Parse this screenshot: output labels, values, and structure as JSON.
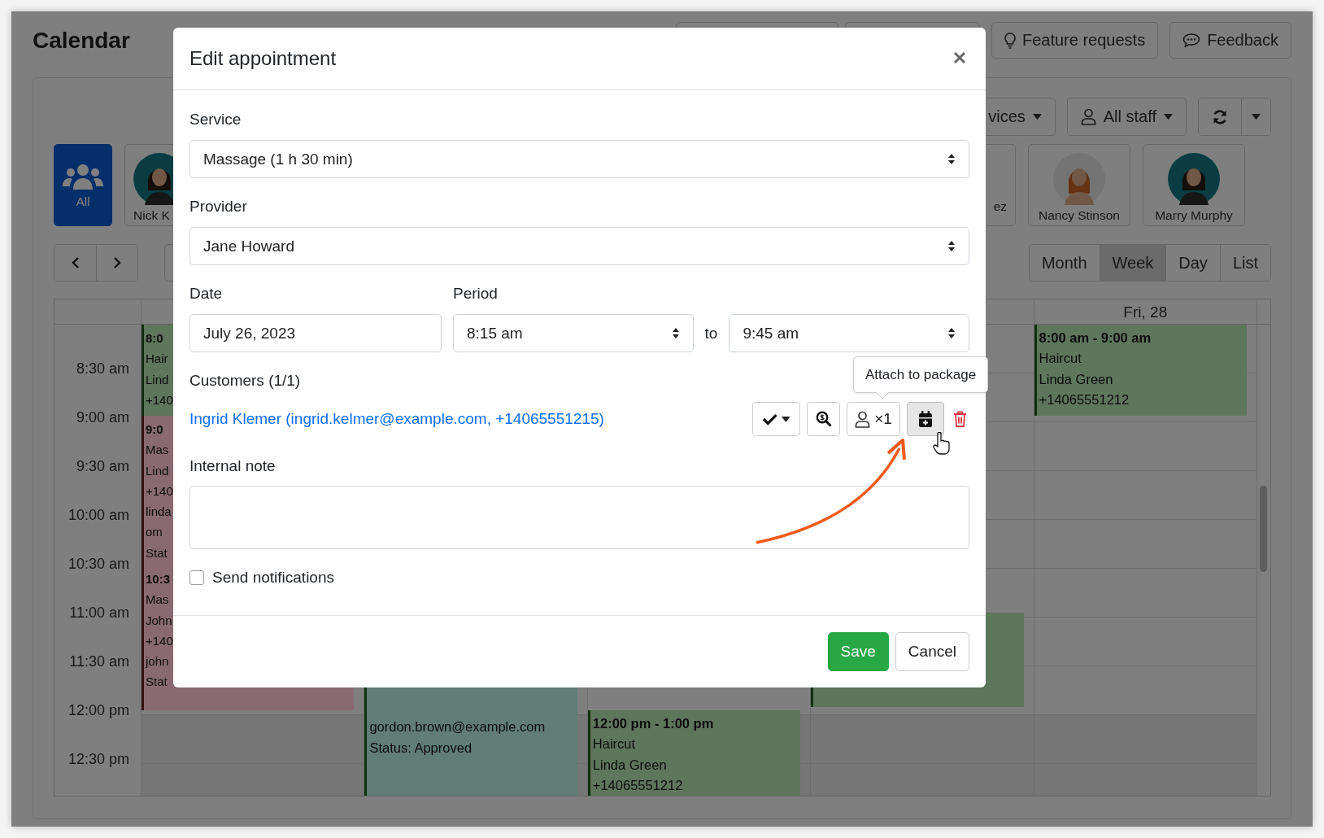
{
  "page": {
    "title": "Calendar"
  },
  "top_buttons": [
    {
      "kind": "blank"
    },
    {
      "kind": "blank"
    },
    {
      "kind": "bulb",
      "label": "Feature requests"
    },
    {
      "kind": "chat",
      "label": "Feedback"
    }
  ],
  "filters": [
    {
      "kind": "dropdown",
      "label": "vices"
    },
    {
      "kind": "staff",
      "label": "All staff"
    },
    {
      "kind": "refresh"
    }
  ],
  "staff": [
    {
      "kind": "group",
      "name": "All",
      "selected": true
    },
    {
      "kind": "avatar_circle",
      "name": "Nick K",
      "selected": false
    },
    {
      "kind": "hidden",
      "name": "ez",
      "selected": false
    },
    {
      "kind": "avatar_plain",
      "name": "Nancy Stinson",
      "selected": false
    },
    {
      "kind": "avatar_circle",
      "name": "Marry Murphy",
      "selected": false
    }
  ],
  "views": [
    {
      "label": "Month",
      "selected": false
    },
    {
      "label": "Week",
      "selected": true
    },
    {
      "label": "Day",
      "selected": false
    },
    {
      "label": "List",
      "selected": false
    }
  ],
  "calendar": {
    "times": [
      "8:30 am",
      "9:00 am",
      "9:30 am",
      "10:00 am",
      "10:30 am",
      "11:00 am",
      "11:30 am",
      "12:00 pm",
      "12:30 pm"
    ],
    "columns": [
      {
        "events": [
          {
            "color": "#5e765c",
            "lines": [
              {
                "text": "8:0",
                "bold": true
              },
              {
                "text": "Hair",
                "bold": false
              },
              {
                "text": "Lind",
                "bold": false
              },
              {
                "text": "+140",
                "bold": false
              }
            ]
          },
          {
            "color": "#8a6a72",
            "lines": [
              {
                "text": "9:0",
                "bold": true
              },
              {
                "text": "Mas",
                "bold": false
              },
              {
                "text": "Lind",
                "bold": false
              },
              {
                "text": "+140",
                "bold": false
              },
              {
                "text": "linda",
                "bold": false
              },
              {
                "text": "om",
                "bold": false
              },
              {
                "text": "Stat",
                "bold": false
              }
            ]
          },
          {
            "color": "#8a6a72",
            "lines": [
              {
                "text": "10:3",
                "bold": true
              },
              {
                "text": "Mas",
                "bold": false
              },
              {
                "text": "John",
                "bold": false
              },
              {
                "text": "+140",
                "bold": false
              },
              {
                "text": "john",
                "bold": false
              },
              {
                "text": "Stat",
                "bold": false
              }
            ]
          }
        ]
      },
      {
        "events": [
          {
            "color": "#607d76",
            "lines": [
              {
                "text": "gordon.brown@example.com",
                "bold": false
              },
              {
                "text": "Status: Approved",
                "bold": false
              }
            ]
          }
        ]
      },
      {
        "events": [
          {
            "color": "#5e765c",
            "lines": [
              {
                "text": "12:00 pm - 1:00 pm",
                "bold": true
              },
              {
                "text": "Haircut",
                "bold": false
              },
              {
                "text": "Linda Green",
                "bold": false
              },
              {
                "text": "+14065551212",
                "bold": false
              }
            ]
          }
        ]
      },
      {
        "events": [
          {
            "color": "#5e765c"
          }
        ]
      },
      {
        "header": "Fri, 28",
        "events": [
          {
            "color": "#5e765c",
            "lines": [
              {
                "text": "8:00 am - 9:00 am",
                "bold": true
              },
              {
                "text": "Haircut",
                "bold": false
              },
              {
                "text": "Linda Green",
                "bold": false
              },
              {
                "text": "+14065551212",
                "bold": false
              }
            ]
          }
        ]
      }
    ]
  },
  "modal": {
    "title": "Edit appointment",
    "service": {
      "label": "Service",
      "value": "Massage (1 h 30 min)"
    },
    "provider": {
      "label": "Provider",
      "value": "Jane Howard"
    },
    "date": {
      "label": "Date",
      "value": "July 26, 2023"
    },
    "period": {
      "label": "Period",
      "from": "8:15 am",
      "separator": "to",
      "to": "9:45 am"
    },
    "customers": {
      "label": "Customers (1/1)",
      "customer": "Ingrid Klemer (ingrid.kelmer@example.com, +14065551215)",
      "actions": [
        {
          "kind": "status",
          "hovered": false
        },
        {
          "kind": "payment",
          "hovered": false
        },
        {
          "kind": "capacity",
          "label": "×1",
          "hovered": false
        },
        {
          "kind": "package",
          "hovered": true
        },
        {
          "kind": "delete",
          "hovered": false
        }
      ],
      "tooltip": "Attach to package"
    },
    "note": {
      "label": "Internal note"
    },
    "notifications": {
      "label": "Send notifications",
      "checked": false
    },
    "buttons": [
      {
        "kind": "primary",
        "label": "Save"
      },
      {
        "kind": "secondary",
        "label": "Cancel"
      }
    ]
  }
}
